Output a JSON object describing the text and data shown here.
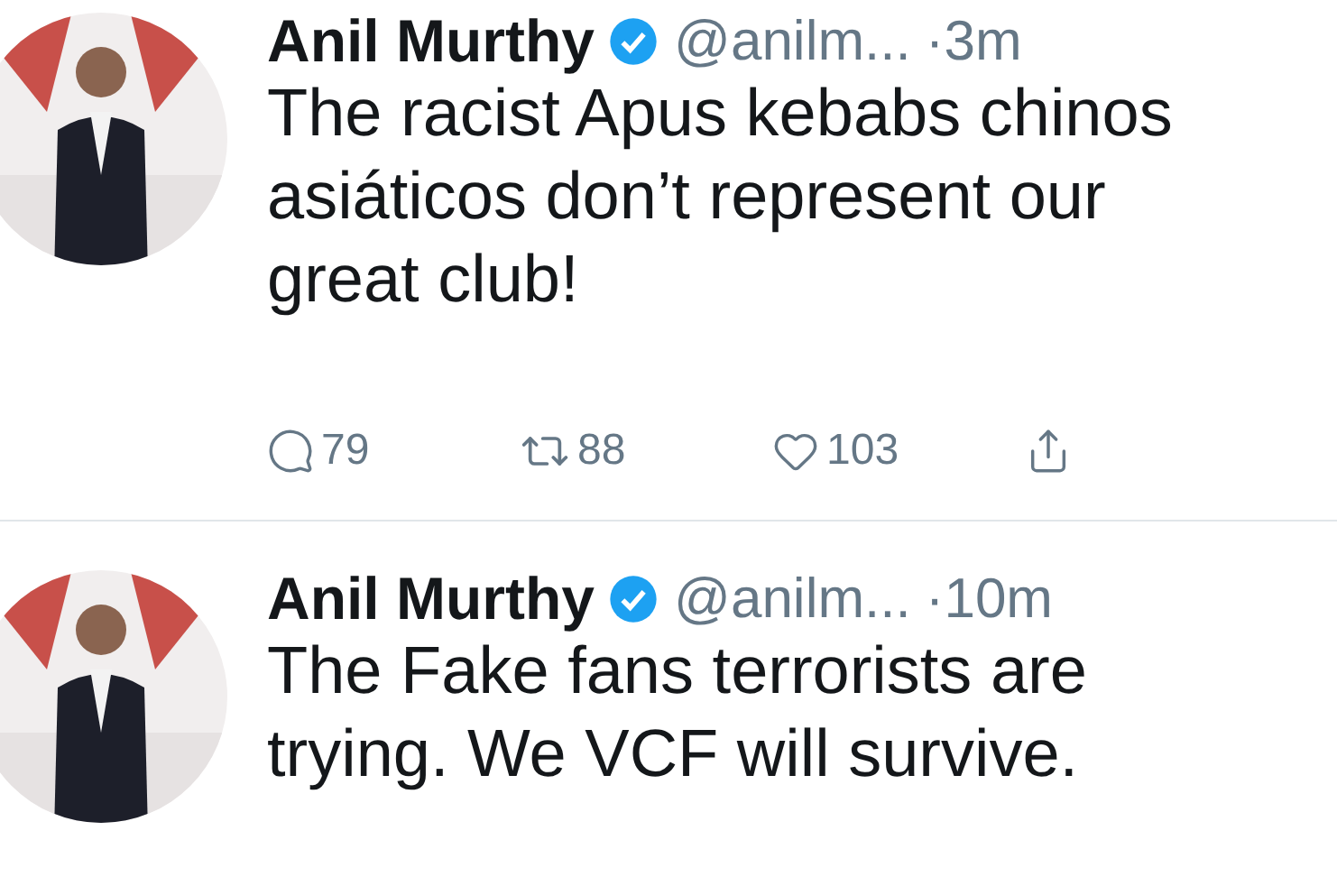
{
  "tweets": [
    {
      "name": "Anil Murthy",
      "verified": true,
      "handle": "@anilm...",
      "time": "·3m",
      "text": "The racist Apus kebabs chinos asiáticos don’t represent our great club!",
      "actions": {
        "replies": "79",
        "retweets": "88",
        "likes": "103"
      }
    },
    {
      "name": "Anil Murthy",
      "verified": true,
      "handle": "@anilm...",
      "time": "·10m",
      "text": "The Fake fans terrorists are trying. We VCF will survive."
    }
  ]
}
